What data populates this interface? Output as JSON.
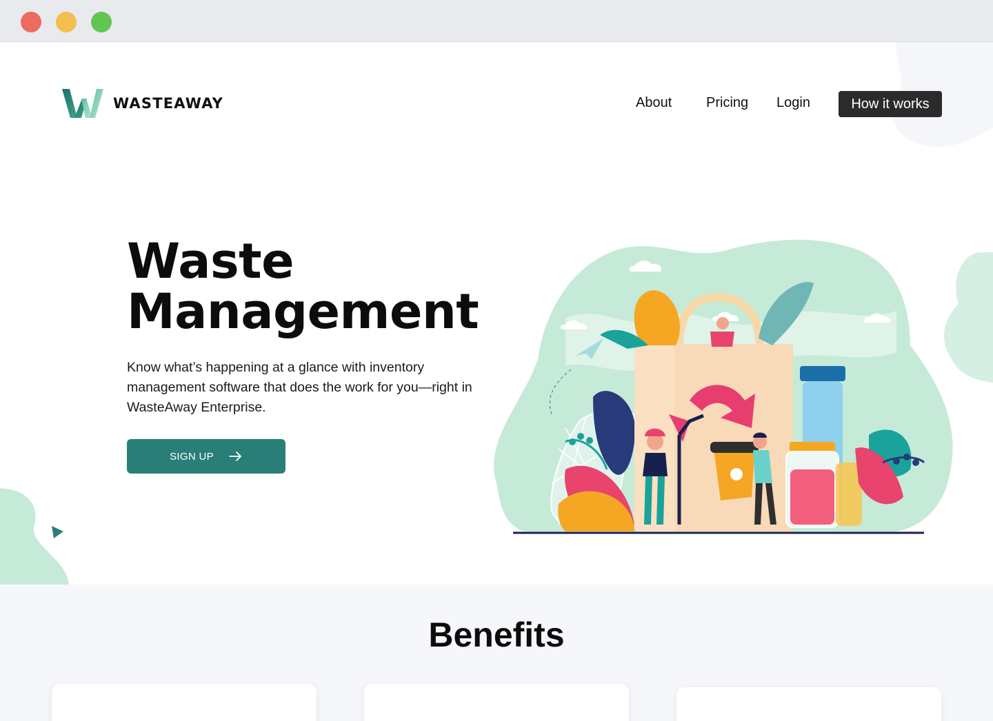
{
  "brand": {
    "name": "WASTEAWAY",
    "logo_icon": "w-logo-icon"
  },
  "nav": {
    "about": "About",
    "pricing": "Pricing",
    "login": "Login",
    "how_it_works": "How it works"
  },
  "hero": {
    "title_line1": "Waste",
    "title_line2": "Management",
    "description": "Know what’s happening at a glance with inventory management software that does the work for you—right in WasteAway Enterprise.",
    "cta": "SIGN UP",
    "cta_icon": "arrow-right-icon",
    "illustration": "shopping-bag-recycling-illustration"
  },
  "benefits": {
    "title": "Benefits"
  },
  "colors": {
    "accent": "#297f77",
    "nav_button": "#2b2b2b",
    "mint": "#c6ead8",
    "window_red": "#ed6a5e",
    "window_yellow": "#f4bf4f",
    "window_green": "#61c554"
  }
}
